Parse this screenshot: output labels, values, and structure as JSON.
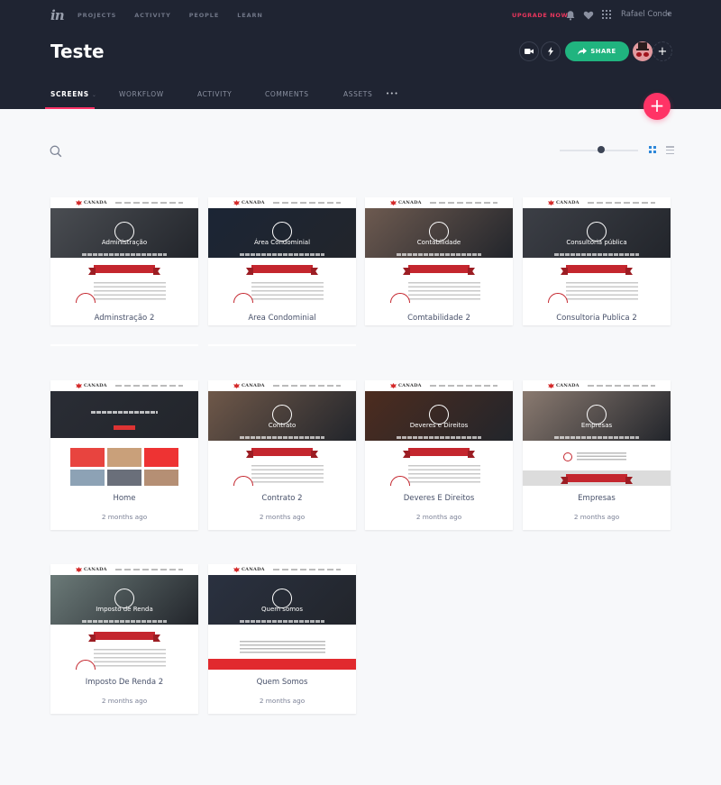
{
  "topnav": {
    "logo": "in",
    "links": [
      "PROJECTS",
      "ACTIVITY",
      "PEOPLE",
      "LEARN"
    ],
    "upgrade_label": "UPGRADE NOW",
    "icons": [
      "bell-icon",
      "heart-icon",
      "apps-grid-icon"
    ],
    "user_name": "Rafael Conde",
    "user_caret": "▾"
  },
  "project": {
    "title": "Teste",
    "actions": {
      "video_icon": "video-camera-icon",
      "lightning_icon": "lightning-icon",
      "share_label": "SHARE",
      "add_collaborator": "+"
    }
  },
  "tabs": [
    {
      "label": "SCREENS",
      "active": true,
      "caret": "⌄"
    },
    {
      "label": "WORKFLOW",
      "active": false
    },
    {
      "label": "ACTIVITY",
      "active": false
    },
    {
      "label": "COMMENTS",
      "active": false
    },
    {
      "label": "ASSETS",
      "active": false
    },
    {
      "label": "•••",
      "active": false
    }
  ],
  "fab_label": "+",
  "toolbar": {
    "search_icon": "search-icon",
    "zoom_level": 0.53,
    "view_mode": "grid"
  },
  "colors": {
    "header_bg": "#1f2432",
    "accent_pink": "#ff3366",
    "share_green": "#20b47f",
    "grid_blue": "#2d87d9",
    "brand_red": "#c4262e"
  },
  "thumb_brand": "CANADA",
  "screens": [
    {
      "title": "Adminstração 2",
      "time": "",
      "hero_title": "Administração",
      "hero_color": "#4a4d52"
    },
    {
      "title": "Area Condominial",
      "time": "",
      "hero_title": "Área Condominial",
      "hero_color": "#1b2535"
    },
    {
      "title": "Comtabilidade 2",
      "time": "",
      "hero_title": "Contabilidade",
      "hero_color": "#6d5a50"
    },
    {
      "title": "Consultoria Publica 2",
      "time": "",
      "hero_title": "Consultoria pública",
      "hero_color": "#3c3f46"
    },
    {
      "title": "Home",
      "time": "2 months ago",
      "hero_title": "",
      "hero_color": "#2a2d35"
    },
    {
      "title": "Contrato 2",
      "time": "2 months ago",
      "hero_title": "Contrato",
      "hero_color": "#6f5849"
    },
    {
      "title": "Deveres E Direitos",
      "time": "2 months ago",
      "hero_title": "Deveres e Direitos",
      "hero_color": "#4d2c1f"
    },
    {
      "title": "Empresas",
      "time": "2 months ago",
      "hero_title": "Empresas",
      "hero_color": "#8a7a70"
    },
    {
      "title": "Imposto De Renda 2",
      "time": "2 months ago",
      "hero_title": "Imposto de Renda",
      "hero_color": "#6b7a78"
    },
    {
      "title": "Quem Somos",
      "time": "2 months ago",
      "hero_title": "Quem somos",
      "hero_color": "#2a3140"
    }
  ]
}
